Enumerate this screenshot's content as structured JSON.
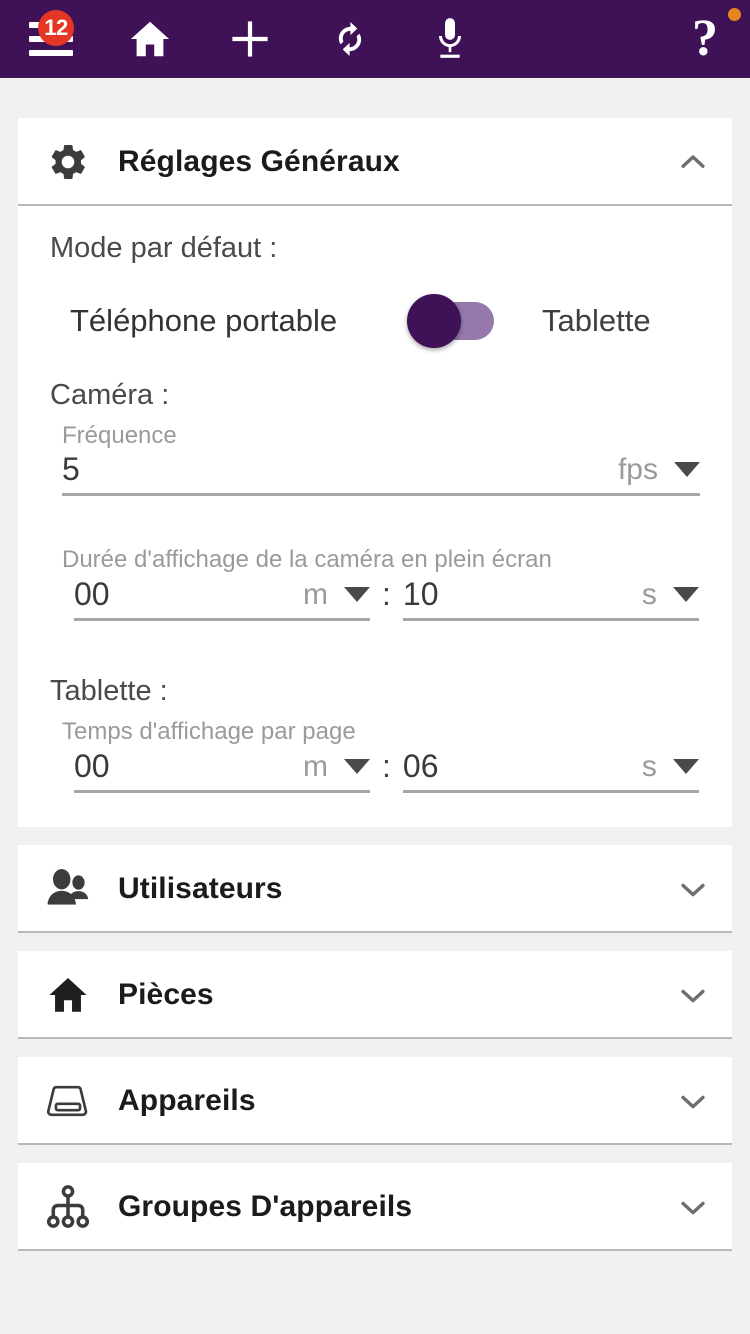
{
  "appbar": {
    "background_color": "#3f1257",
    "menu_badge_count": "12",
    "icons": [
      {
        "name": "menu-icon",
        "label": "Menu"
      },
      {
        "name": "home-icon",
        "label": "Accueil"
      },
      {
        "name": "add-icon",
        "label": "Ajouter"
      },
      {
        "name": "sync-icon",
        "label": "Synchroniser"
      },
      {
        "name": "microphone-icon",
        "label": "Micro"
      },
      {
        "name": "help-icon",
        "label": "?"
      }
    ],
    "help_glyph": "?",
    "corner_dot_color": "#e8861e"
  },
  "general": {
    "title": "Réglages Généraux",
    "icon": "gear-icon",
    "expanded": true,
    "chevron": "chevron-up-icon",
    "mode_label": "Mode par défaut :",
    "mode_option_left": "Téléphone portable",
    "mode_option_right": "Tablette",
    "toggle_state": "left",
    "toggle_track_color": "#9579ad",
    "toggle_knob_color": "#3f1257",
    "camera_label": "Caméra :",
    "frequency": {
      "label": "Fréquence",
      "value": "5",
      "unit": "fps"
    },
    "fullscreen_duration": {
      "label": "Durée d'affichage de la caméra en plein écran",
      "minutes_value": "00",
      "minutes_unit": "m",
      "separator": ":",
      "seconds_value": "10",
      "seconds_unit": "s"
    },
    "tablet_label": "Tablette :",
    "page_display_time": {
      "label": "Temps d'affichage par page",
      "minutes_value": "00",
      "minutes_unit": "m",
      "separator": ":",
      "seconds_value": "06",
      "seconds_unit": "s"
    }
  },
  "sections": [
    {
      "title": "Utilisateurs",
      "icon": "users-icon",
      "chevron": "chevron-down-icon"
    },
    {
      "title": "Pièces",
      "icon": "home-icon",
      "chevron": "chevron-down-icon"
    },
    {
      "title": "Appareils",
      "icon": "device-icon",
      "chevron": "chevron-down-icon"
    },
    {
      "title": "Groupes D'appareils",
      "icon": "sitemap-icon",
      "chevron": "chevron-down-icon"
    }
  ]
}
